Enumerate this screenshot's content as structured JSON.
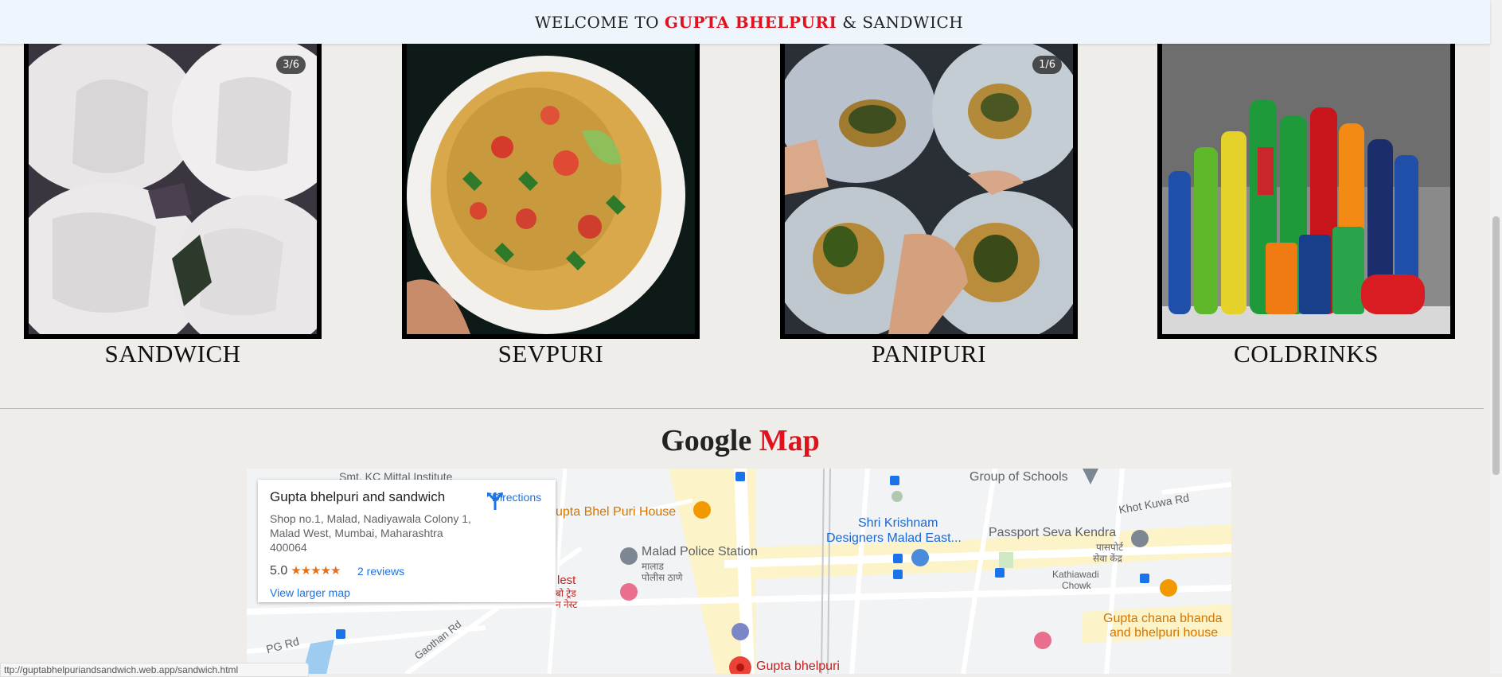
{
  "header": {
    "welcome_prefix": "WELCOME TO",
    "brand": "GUPTA BHELPURI",
    "welcome_suffix": "& SANDWICH"
  },
  "gallery": [
    {
      "label": "SANDWICH",
      "badge": "3/6"
    },
    {
      "label": "SEVPURI",
      "badge": ""
    },
    {
      "label": "PANIPURI",
      "badge": "1/6"
    },
    {
      "label": "COLDRINKS",
      "badge": ""
    }
  ],
  "map_section": {
    "heading_part1": "Google",
    "heading_part2": "Map"
  },
  "map": {
    "place_name": "Gupta bhelpuri and sandwich",
    "address": "Shop no.1, Malad, Nadiyawala Colony 1, Malad West, Mumbai, Maharashtra 400064",
    "rating": "5.0",
    "stars": "★★★★★",
    "reviews": "2 reviews",
    "view_larger": "View larger map",
    "directions": "Directions",
    "labels": {
      "group_schools": "Group of Schools",
      "khot_kuwa": "Khot Kuwa Rd",
      "bhel_puri_house": "upta Bhel Puri House",
      "shri_krishnam": "Shri Krishnam",
      "designers": "Designers Malad East...",
      "passport": "Passport Seva Kendra",
      "passport_hi": "पासपोर्ट",
      "passport_hi2": "सेवा केंद्र",
      "police": "Malad Police Station",
      "police_hi": "मालाड",
      "police_hi2": "पोलीस ठाणे",
      "kathiawadi": "Kathiawadi",
      "chowk": "Chowk",
      "chana_bhanda": "Gupta chana bhanda",
      "chana_bhanda2": "and bhelpuri house",
      "pg_rd": "PG Rd",
      "gaothan": "Gaothan Rd",
      "gupta_pin": "Gupta bhelpuri",
      "mittal": "Smt. KC Mittal Institute",
      "lest": "lest",
      "lest_hi": "बो ट्रेड",
      "lest_hi2": "न नेस्ट"
    }
  },
  "status_bar": {
    "url": "ttp://guptabhelpuriandsandwich.web.app/sandwich.html"
  },
  "colors": {
    "brand_red": "#e0121d",
    "link_blue": "#1a73e8",
    "header_bg": "#eef5fd"
  }
}
